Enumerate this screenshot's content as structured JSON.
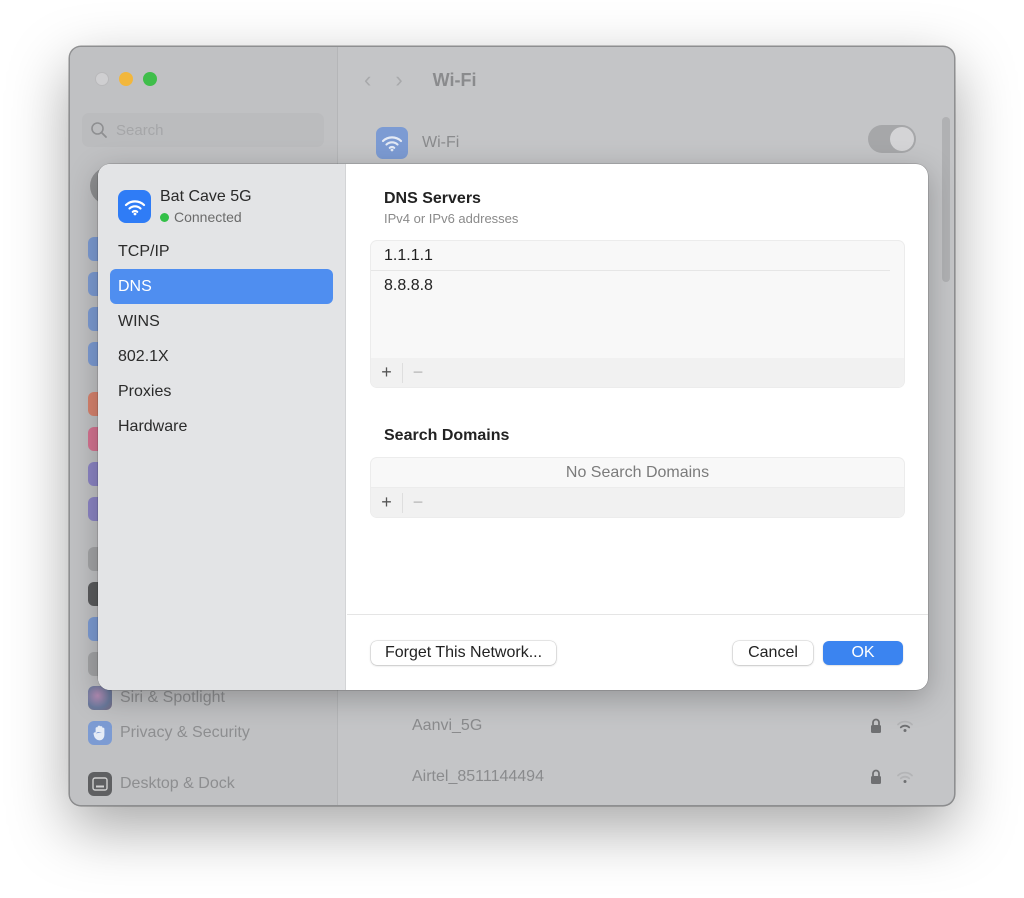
{
  "window": {
    "search_placeholder": "Search",
    "nav_title": "Wi-Fi",
    "wifi_row_label": "Wi-Fi",
    "wifi_enabled": true,
    "sidebar_visible_items": [
      {
        "label": "Siri & Spotlight",
        "icon": "siri-icon"
      },
      {
        "label": "Privacy & Security",
        "icon": "hand-icon"
      },
      {
        "label": "Desktop & Dock",
        "icon": "dock-icon"
      }
    ],
    "networks": [
      {
        "name": "Aanvi_5G",
        "locked": true,
        "icon": "wifi-icon"
      },
      {
        "name": "Airtel_8511144494",
        "locked": true,
        "icon": "wifi-icon"
      }
    ]
  },
  "sheet": {
    "network_name": "Bat Cave 5G",
    "network_status": "Connected",
    "tabs": [
      {
        "label": "TCP/IP",
        "active": false
      },
      {
        "label": "DNS",
        "active": true
      },
      {
        "label": "WINS",
        "active": false
      },
      {
        "label": "802.1X",
        "active": false
      },
      {
        "label": "Proxies",
        "active": false
      },
      {
        "label": "Hardware",
        "active": false
      }
    ],
    "dns": {
      "title": "DNS Servers",
      "subtitle": "IPv4 or IPv6 addresses",
      "servers": [
        "1.1.1.1",
        "8.8.8.8"
      ]
    },
    "search_domains": {
      "title": "Search Domains",
      "empty_text": "No Search Domains"
    },
    "add_label": "+",
    "remove_label": "−",
    "buttons": {
      "forget": "Forget This Network...",
      "cancel": "Cancel",
      "ok": "OK"
    }
  },
  "colors": {
    "accent": "#3b84f0",
    "selected_tab": "#4f8ef0",
    "connected_dot": "#33c048"
  }
}
